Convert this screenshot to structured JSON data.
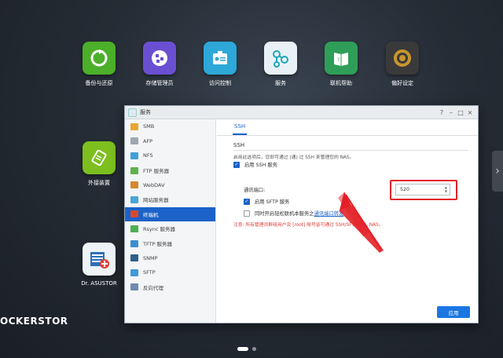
{
  "desktop": {
    "icons": [
      {
        "label": "备份与还原",
        "icon": "refresh-icon"
      },
      {
        "label": "存储管理员",
        "icon": "storage-icon"
      },
      {
        "label": "访问控制",
        "icon": "id-card-icon"
      },
      {
        "label": "服务",
        "icon": "network-icon"
      },
      {
        "label": "联机帮助",
        "icon": "help-book-icon"
      },
      {
        "label": "偏好设定",
        "icon": "gear-icon"
      },
      {
        "label": "外接装置",
        "icon": "external-device-icon"
      },
      {
        "label": "Dr. ASUSTOR",
        "icon": "dr-asustor-icon"
      }
    ],
    "brand": "OCKERSTOR"
  },
  "window": {
    "title": "服务",
    "sidebar": [
      {
        "label": "SMB"
      },
      {
        "label": "AFP"
      },
      {
        "label": "NFS"
      },
      {
        "label": "FTP 服务器"
      },
      {
        "label": "WebDAV"
      },
      {
        "label": "网站服务器"
      },
      {
        "label": "终端机"
      },
      {
        "label": "Rsync 服务器"
      },
      {
        "label": "TFTP 服务器"
      },
      {
        "label": "SNMP"
      },
      {
        "label": "SFTP"
      },
      {
        "label": "反向代理"
      }
    ],
    "active_index": 6,
    "tab": "SSH",
    "section_title": "SSH",
    "description": "启用此选项后，您即可通过 (通) 过 SSH 来管理您的 NAS。",
    "enable_ssh_label": "启用 SSH 服务",
    "port_label": "通讯端口:",
    "port_value": "520",
    "enable_sftp_label": "启用 SFTP 服务",
    "bruteforce_label_prefix": "同时开启轻松联机本服务之",
    "bruteforce_link": "通讯端口转发",
    "note": "注意: 所有管理员群组用户及 [root] 账号皆可通过 SSH/SFTP 登入 NAS。",
    "apply_label": "应用",
    "accent": "#1c62c9",
    "highlight": "#e32027"
  }
}
